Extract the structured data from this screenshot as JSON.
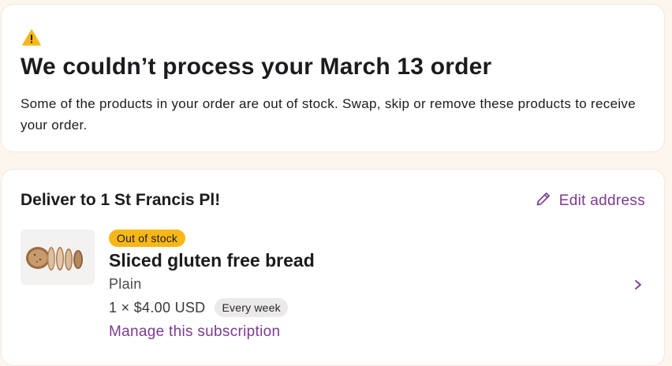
{
  "alert": {
    "icon": "warning-icon",
    "title": "We couldn’t process your March 13 order",
    "body": "Some of the products in your order are out of stock. Swap, skip or remove these products to receive your order."
  },
  "delivery": {
    "title": "Deliver to 1 St Francis Pl!",
    "edit_label": "Edit address"
  },
  "product": {
    "badge": "Out of stock",
    "name": "Sliced gluten free bread",
    "variant": "Plain",
    "price": "1 × $4.00 USD",
    "frequency": "Every week",
    "manage_label": "Manage this subscription"
  },
  "colors": {
    "accent": "#7b3b8e",
    "warning": "#f7b718",
    "background": "#fdf6ef"
  }
}
